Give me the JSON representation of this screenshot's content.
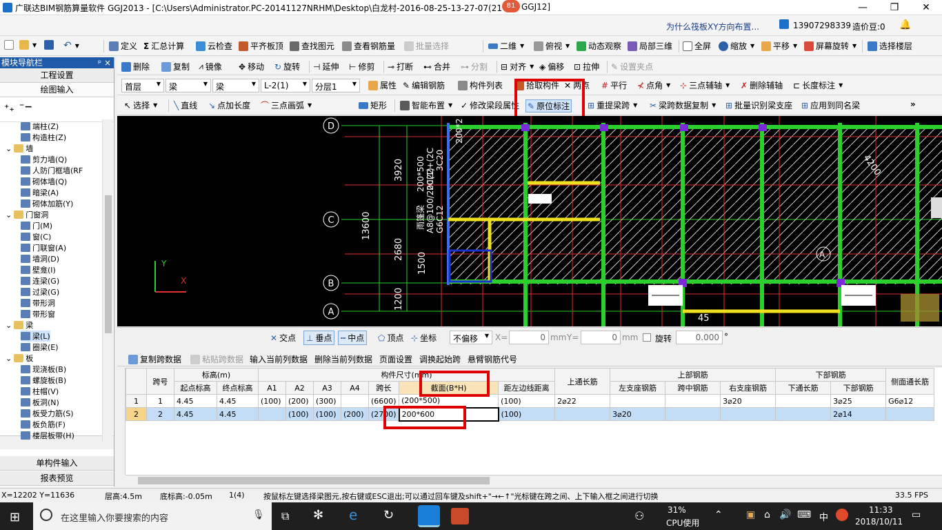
{
  "window": {
    "title": "广联达BIM钢筋算量软件 GGJ2013 - [C:\\Users\\Administrator.PC-20141127NRHM\\Desktop\\白龙村-2016-08-25-13-27-07(21",
    "title_tail": "GGJ12]",
    "badge": "81",
    "min": "—",
    "max": "❐",
    "close": "✕"
  },
  "info_bar": {
    "question": "为什么筏板XY方向布置...",
    "phone": "13907298339",
    "cost_bean": "造价豆:0"
  },
  "toolbar1": {
    "define": "定义",
    "sum": "汇总计算",
    "cloud": "云检查",
    "flat": "平齐板顶",
    "find": "查找图元",
    "view_rebar": "查看钢筋量",
    "batch": "批量选择",
    "view2d": "二维",
    "topview": "俯视",
    "dynamic": "动态观察",
    "local3d": "局部三维",
    "fullscreen": "全屏",
    "zoom": "缩放",
    "pan": "平移",
    "rotate_screen": "屏幕旋转",
    "select_floor": "选择楼层"
  },
  "toolbar2": {
    "delete": "删除",
    "copy": "复制",
    "mirror": "镜像",
    "move": "移动",
    "rotate": "旋转",
    "extend": "延伸",
    "trim": "修剪",
    "break": "打断",
    "merge": "合并",
    "split": "分割",
    "align": "对齐",
    "offset": "偏移",
    "stretch": "拉伸",
    "set_point": "设置夹点"
  },
  "toolbar3": {
    "floor": "首层",
    "cat1": "梁",
    "cat2": "梁",
    "member": "L-2(1)",
    "layer": "分层1",
    "attr": "属性",
    "edit_rebar": "编辑钢筋",
    "member_list": "构件列表",
    "pick": "拾取构件",
    "twopoint": "两点",
    "parallel": "平行",
    "angle": "点角",
    "three_axis": "三点辅轴",
    "del_axis": "删除辅轴",
    "dim": "长度标注"
  },
  "toolbar4": {
    "select": "选择",
    "line": "直线",
    "point_len": "点加长度",
    "arc3": "三点画弧",
    "rect": "矩形",
    "smart": "智能布置",
    "modify_seg": "修改梁段属性",
    "inplace": "原位标注",
    "reextract": "重提梁跨",
    "span_copy": "梁跨数据复制",
    "batch_identify": "批量识别梁支座",
    "apply_same": "应用到同名梁"
  },
  "panel": {
    "title": "模块导航栏",
    "pin": "ᵖ ×",
    "project": "工程设置",
    "draw": "绘图输入",
    "single": "单构件输入",
    "report": "报表预览",
    "tree": [
      {
        "label": "端柱(Z)",
        "indent": 2
      },
      {
        "label": "构造柱(Z)",
        "indent": 2
      },
      {
        "label": "墙",
        "indent": 1,
        "folder": true
      },
      {
        "label": "剪力墙(Q)",
        "indent": 2
      },
      {
        "label": "人防门框墙(RF",
        "indent": 2
      },
      {
        "label": "砌体墙(Q)",
        "indent": 2
      },
      {
        "label": "暗梁(A)",
        "indent": 2
      },
      {
        "label": "砌体加筋(Y)",
        "indent": 2
      },
      {
        "label": "门窗洞",
        "indent": 1,
        "folder": true
      },
      {
        "label": "门(M)",
        "indent": 2
      },
      {
        "label": "窗(C)",
        "indent": 2
      },
      {
        "label": "门联窗(A)",
        "indent": 2
      },
      {
        "label": "墙洞(D)",
        "indent": 2
      },
      {
        "label": "壁龛(I)",
        "indent": 2
      },
      {
        "label": "连梁(G)",
        "indent": 2
      },
      {
        "label": "过梁(G)",
        "indent": 2
      },
      {
        "label": "带形洞",
        "indent": 2
      },
      {
        "label": "带形窗",
        "indent": 2
      },
      {
        "label": "梁",
        "indent": 1,
        "folder": true
      },
      {
        "label": "梁(L)",
        "indent": 2,
        "selected": true
      },
      {
        "label": "圈梁(E)",
        "indent": 2
      },
      {
        "label": "板",
        "indent": 1,
        "folder": true
      },
      {
        "label": "现浇板(B)",
        "indent": 2
      },
      {
        "label": "螺旋板(B)",
        "indent": 2
      },
      {
        "label": "柱帽(V)",
        "indent": 2
      },
      {
        "label": "板洞(N)",
        "indent": 2
      },
      {
        "label": "板受力筋(S)",
        "indent": 2
      },
      {
        "label": "板负筋(F)",
        "indent": 2
      },
      {
        "label": "楼层板带(H)",
        "indent": 2
      }
    ]
  },
  "drawing": {
    "axes": [
      "D",
      "C",
      "B",
      "A"
    ],
    "dims": [
      "3920",
      "13600",
      "2680",
      "1500",
      "1200",
      "4200",
      "45"
    ],
    "beam_text1": "200*500",
    "beam_text2": "2C22+(2C",
    "beam_text3": "3C20",
    "beam_text4": "A8@100/200(1)",
    "beam_text5": "G6C12",
    "beam_text6": "雨篷梁",
    "beam_text7": "200*2",
    "ucs_y": "Y",
    "ucs_x": "X",
    "mark_a": "A"
  },
  "snapbar": {
    "intersect": "交点",
    "perp": "垂点",
    "mid": "中点",
    "vertex": "顶点",
    "coord": "坐标",
    "offset_mode": "不偏移",
    "x_label": "X=",
    "x_val": "0",
    "mm1": "mm",
    "y_label": "Y=",
    "y_val": "0",
    "mm2": "mm",
    "rotate": "旋转",
    "rot_val": "0.000",
    "deg": "°"
  },
  "tablebar": {
    "copy_span": "复制跨数据",
    "paste_span": "粘贴跨数据",
    "input_col": "输入当前列数据",
    "del_col": "删除当前列数据",
    "page_setup": "页面设置",
    "adjust_start": "调换起始跨",
    "cantilever": "悬臂钢筋代号"
  },
  "table": {
    "h_span": "跨号",
    "h_elev": "标高(m)",
    "h_start": "起点标高",
    "h_end": "终点标高",
    "h_size": "构件尺寸(mm)",
    "h_a1": "A1",
    "h_a2": "A2",
    "h_a3": "A3",
    "h_a4": "A4",
    "h_len": "跨长",
    "h_section": "截面(B*H)",
    "h_dist": "距左边线距离",
    "h_top_long": "上通长筋",
    "h_top": "上部钢筋",
    "h_left": "左支座钢筋",
    "h_mid": "跨中钢筋",
    "h_right": "右支座钢筋",
    "h_bottom": "下部钢筋",
    "h_bot_long": "下通长筋",
    "h_bot": "下部钢筋",
    "h_side": "侧面通长筋",
    "rows": [
      {
        "n": "1",
        "span": "1",
        "start": "4.45",
        "end": "4.45",
        "a1": "(100)",
        "a2": "(200)",
        "a3": "(300)",
        "a4": "",
        "len": "(6600)",
        "section": "(200*500)",
        "dist": "(100)",
        "top_long": "2⌀22",
        "left": "",
        "mid": "",
        "right": "3⌀20",
        "bot_long": "",
        "bot": "3⌀25",
        "side": "G6⌀12"
      },
      {
        "n": "2",
        "span": "2",
        "start": "4.45",
        "end": "4.45",
        "a1": "",
        "a2": "(100)",
        "a3": "(100)",
        "a4": "(200)",
        "len": "(2700)",
        "section": "200*600",
        "dist": "(100)",
        "top_long": "",
        "left": "3⌀20",
        "mid": "",
        "right": "",
        "bot_long": "",
        "bot": "2⌀14",
        "side": ""
      }
    ]
  },
  "status": {
    "coords": "X=12202 Y=11636",
    "floor_h": "层高:4.5m",
    "base_h": "底标高:-0.05m",
    "count": "1(4)",
    "hint": "按鼠标左键选择梁图元,按右键或ESC退出;可以通过回车键及shift+\"→←↑\"光标键在跨之间、上下输入框之间进行切换",
    "fps": "33.5 FPS"
  },
  "taskbar": {
    "search": "在这里输入你要搜索的内容",
    "cpu_pct": "31%",
    "cpu_label": "CPU使用",
    "ime": "中",
    "time": "11:33",
    "date": "2018/10/11"
  }
}
